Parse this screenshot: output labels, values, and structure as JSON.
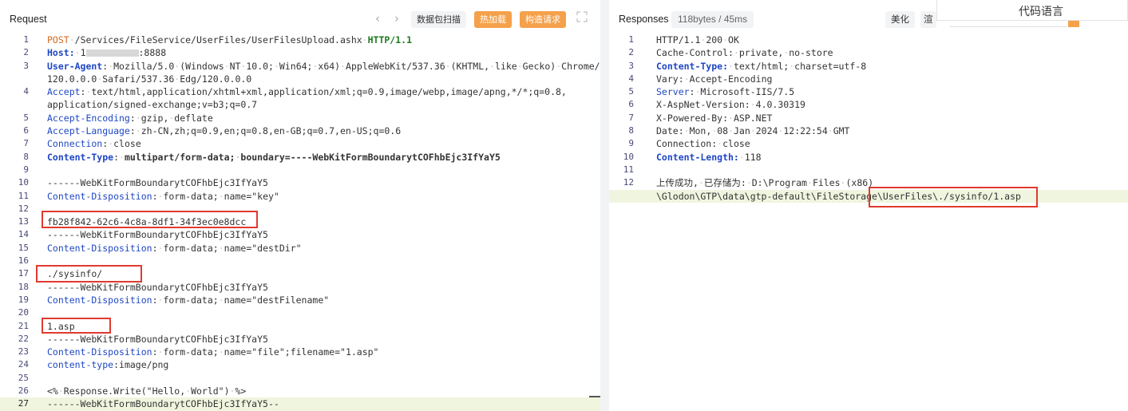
{
  "request": {
    "title": "Request",
    "toolbar": {
      "prev": "‹",
      "next": "›",
      "scan": "数据包扫描",
      "hot_load": "热加载",
      "build_request": "构造请求"
    },
    "line_numbers": [
      "1",
      "2",
      "3",
      "",
      "4",
      "",
      "5",
      "6",
      "7",
      "8",
      "9",
      "10",
      "11",
      "12",
      "13",
      "14",
      "15",
      "16",
      "17",
      "18",
      "19",
      "20",
      "21",
      "22",
      "23",
      "24",
      "25",
      "26",
      "27"
    ]
  },
  "response": {
    "title": "Responses",
    "meta": "118bytes / 45ms",
    "beautify": "美化",
    "render": "渲染",
    "line_numbers": [
      "1",
      "2",
      "3",
      "4",
      "5",
      "6",
      "7",
      "8",
      "9",
      "10",
      "11",
      "12",
      ""
    ]
  },
  "overlay": {
    "code_language": "代码语言"
  }
}
